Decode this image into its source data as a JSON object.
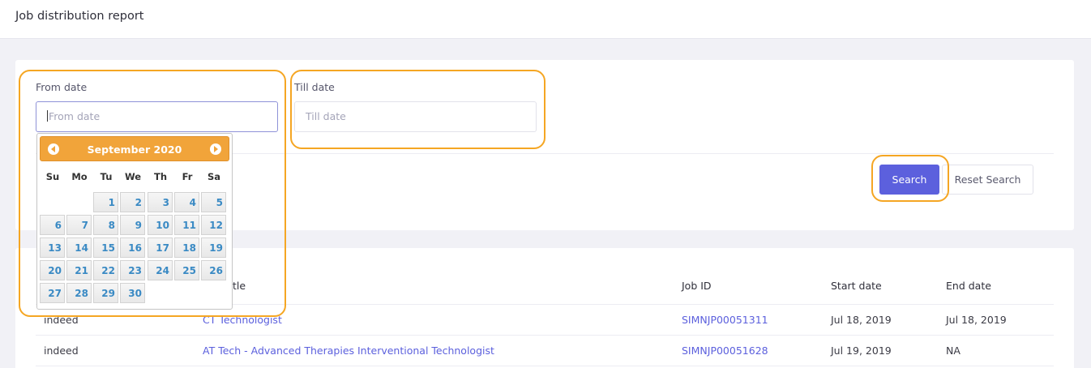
{
  "page": {
    "title": "Job distribution report"
  },
  "filters": {
    "from_label": "From date",
    "from_placeholder": "From date",
    "till_label": "Till date",
    "till_placeholder": "Till date",
    "search_label": "Search",
    "reset_label": "Reset Search"
  },
  "datepicker": {
    "title": "September 2020",
    "weekdays": [
      "Su",
      "Mo",
      "Tu",
      "We",
      "Th",
      "Fr",
      "Sa"
    ],
    "first_weekday_index": 2,
    "days_in_month": 30,
    "prev_icon": "chevron-left-icon",
    "next_icon": "chevron-right-icon"
  },
  "table": {
    "headers": [
      "Job title",
      "Job ID",
      "Start date",
      "End date"
    ],
    "header_partial_visible": "tle",
    "rows": [
      {
        "source": "indeed",
        "title": "CT Technologist",
        "job_id": "SIMNJP00051311",
        "start": "Jul 18, 2019",
        "end": "Jul 18, 2019"
      },
      {
        "source": "indeed",
        "title": "AT Tech - Advanced Therapies Interventional Technologist",
        "job_id": "SIMNJP00051628",
        "start": "Jul 19, 2019",
        "end": "NA"
      }
    ]
  },
  "colors": {
    "accent": "#5c60dd",
    "highlight": "#f5a623",
    "datepicker_header": "#f1a43a",
    "link": "#5c60dd"
  }
}
